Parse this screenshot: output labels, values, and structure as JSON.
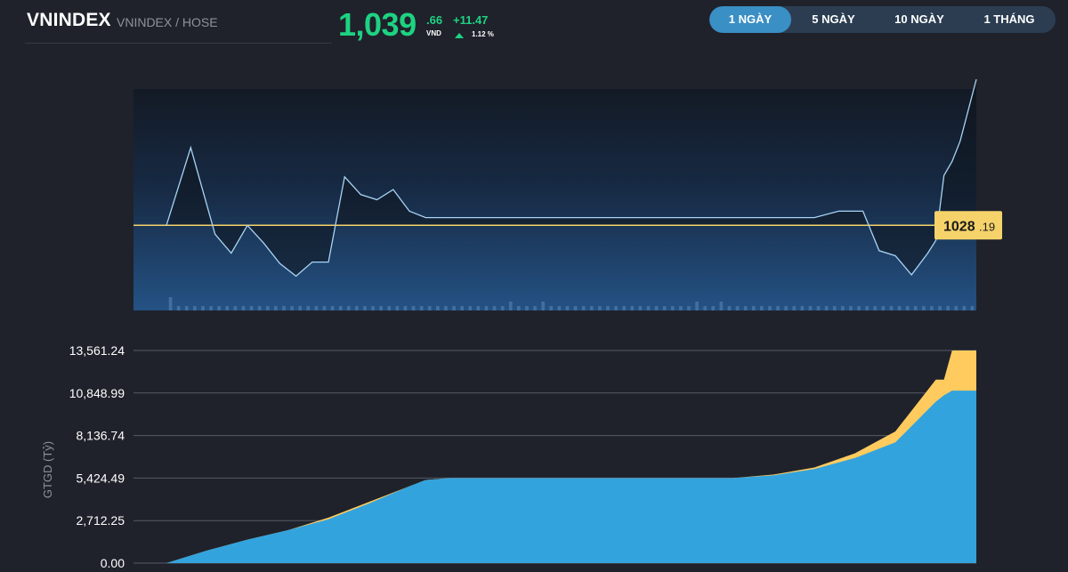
{
  "header": {
    "ticker": "VNINDEX",
    "exchange": "VNINDEX / HOSE",
    "price_main": "1,039",
    "price_decimal": ".66",
    "price_unit": "VND",
    "change_abs": "+11.47",
    "change_pct": "1.12 %"
  },
  "range_tabs": [
    {
      "label": "1 NGÀY",
      "active": true
    },
    {
      "label": "5 NGÀY",
      "active": false
    },
    {
      "label": "10 NGÀY",
      "active": false
    },
    {
      "label": "1 THÁNG",
      "active": false
    }
  ],
  "colors": {
    "background": "#1f222b",
    "up_green": "#1ed282",
    "reference_line": "#f5d36a",
    "price_line": "#a8d4f5",
    "value_area_blue": "#33a3dd",
    "value_area_yellow": "#ffcb5e",
    "tab_active": "#3a8fc4",
    "tab_bg": "#2c3d52"
  },
  "chart_data": [
    {
      "type": "line",
      "reference": {
        "label_int": "1028",
        "label_dec": ".19",
        "value": 1028.19
      },
      "x": [
        0,
        3,
        6,
        8,
        10,
        12,
        14,
        16,
        18,
        20,
        22,
        24,
        26,
        28,
        30,
        32,
        34,
        36,
        38,
        40,
        42,
        44,
        46,
        48,
        50,
        52,
        55,
        58,
        62,
        66,
        70,
        75,
        80,
        83,
        86,
        88,
        90,
        92,
        94,
        95,
        96,
        97,
        98,
        100
      ],
      "values": [
        1028.19,
        1034.3,
        1027.5,
        1026.0,
        1028.19,
        1026.8,
        1025.2,
        1024.2,
        1025.3,
        1025.3,
        1032.0,
        1030.6,
        1030.2,
        1031.0,
        1029.3,
        1028.8,
        1028.8,
        1028.8,
        1028.8,
        1028.8,
        1028.8,
        1028.8,
        1028.8,
        1028.8,
        1028.8,
        1028.8,
        1028.8,
        1028.8,
        1028.8,
        1028.8,
        1028.8,
        1028.8,
        1028.8,
        1029.3,
        1029.3,
        1026.2,
        1025.8,
        1024.3,
        1026.0,
        1027.0,
        1032.1,
        1033.2,
        1034.8,
        1039.66
      ],
      "ylim": [
        1021.5,
        1041.0
      ],
      "volume_bars": [
        3,
        1,
        1,
        1,
        1,
        1,
        1,
        1,
        1,
        1,
        1,
        1,
        1,
        1,
        1,
        1,
        1,
        1,
        1,
        1,
        1,
        1,
        1,
        1,
        1,
        1,
        1,
        1,
        1,
        1,
        1,
        1,
        1,
        1,
        1,
        1,
        1,
        1,
        1,
        1,
        1,
        1,
        2,
        1,
        1,
        1,
        2,
        1,
        1,
        1,
        1,
        1,
        1,
        1,
        1,
        1,
        1,
        1,
        1,
        1,
        1,
        1,
        1,
        1,
        1,
        2,
        1,
        1,
        2,
        1,
        1,
        1,
        1,
        1,
        1,
        1,
        1,
        1,
        1,
        1,
        1,
        1,
        1,
        1,
        1,
        1,
        1,
        1,
        1,
        1,
        1,
        1,
        1,
        1,
        1,
        1,
        1,
        1,
        1,
        1
      ]
    },
    {
      "type": "area",
      "ylabel": "GTGD (Tỷ)",
      "yticks": [
        "13,561.24",
        "10,848.99",
        "8,136.74",
        "5,424.49",
        "2,712.25",
        "0.00"
      ],
      "ytick_values": [
        13561.24,
        10848.99,
        8136.74,
        5424.49,
        2712.25,
        0.0
      ],
      "ylim": [
        0,
        13561.24
      ],
      "x": [
        0,
        5,
        10,
        15,
        20,
        25,
        30,
        32,
        35,
        40,
        45,
        50,
        55,
        60,
        65,
        70,
        75,
        80,
        85,
        90,
        95,
        96,
        97,
        100
      ],
      "series": [
        {
          "values": [
            0,
            800,
            1500,
            2100,
            2800,
            3800,
            4900,
            5300,
            5424,
            5424,
            5424,
            5424,
            5424,
            5424,
            5424,
            5424,
            5600,
            6000,
            6700,
            7700,
            10300,
            10700,
            11000,
            11000
          ]
        },
        {
          "values": [
            0,
            800,
            1500,
            2100,
            2900,
            3900,
            4900,
            5300,
            5424,
            5424,
            5424,
            5424,
            5424,
            5424,
            5424,
            5424,
            5650,
            6100,
            7000,
            8400,
            11700,
            11700,
            13561,
            13561
          ]
        }
      ]
    }
  ]
}
